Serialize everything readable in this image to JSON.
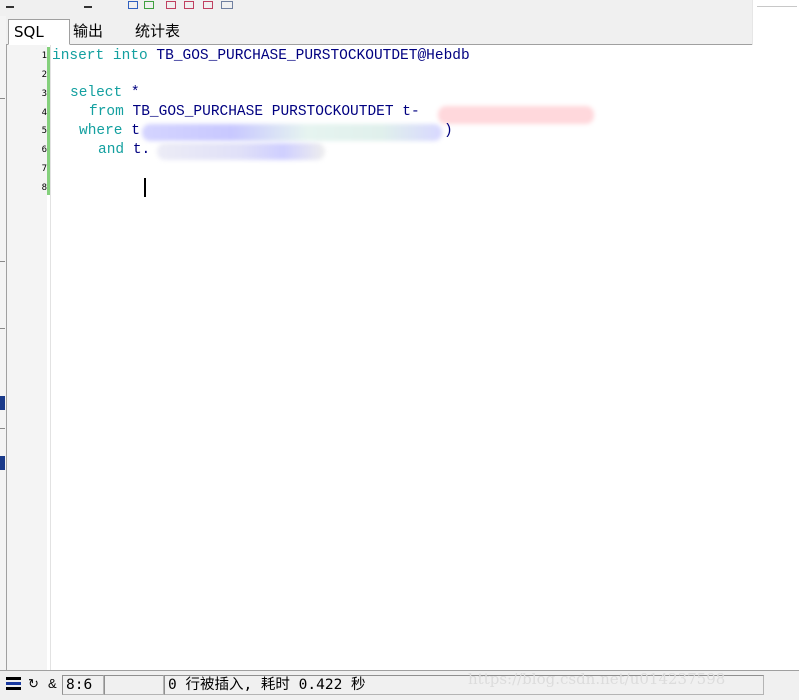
{
  "tabs": [
    {
      "label": "SQL",
      "active": true
    },
    {
      "label": "输出",
      "active": false
    },
    {
      "label": "统计表",
      "active": false
    }
  ],
  "editor": {
    "line_numbers": [
      "1",
      "2",
      "3",
      "4",
      "5",
      "6",
      "7",
      "8"
    ],
    "lines": {
      "l1": {
        "kw": "insert into",
        "rest": "TB_GOS_PURCHASE_PURSTOCKOUTDET@Hebdb"
      },
      "l3": {
        "kw": "select",
        "rest": "*"
      },
      "l4": {
        "kw": "from",
        "rest": "TB_GOS_PURCHASE PURSTOCKOUTDET t-"
      },
      "l5": {
        "kw": "where",
        "rest": "t",
        "tail": ")"
      },
      "l6": {
        "kw": "and",
        "rest": "t."
      }
    },
    "caret_line": 8
  },
  "status": {
    "position": "8:6",
    "message": "0 行被插入, 耗时 0.422 秒"
  },
  "watermark": "https://blog.csdn.net/u014237598",
  "colors": {
    "keyword": "#14a0a0",
    "identifier": "#000080",
    "fold_bar": "#84d07c"
  }
}
